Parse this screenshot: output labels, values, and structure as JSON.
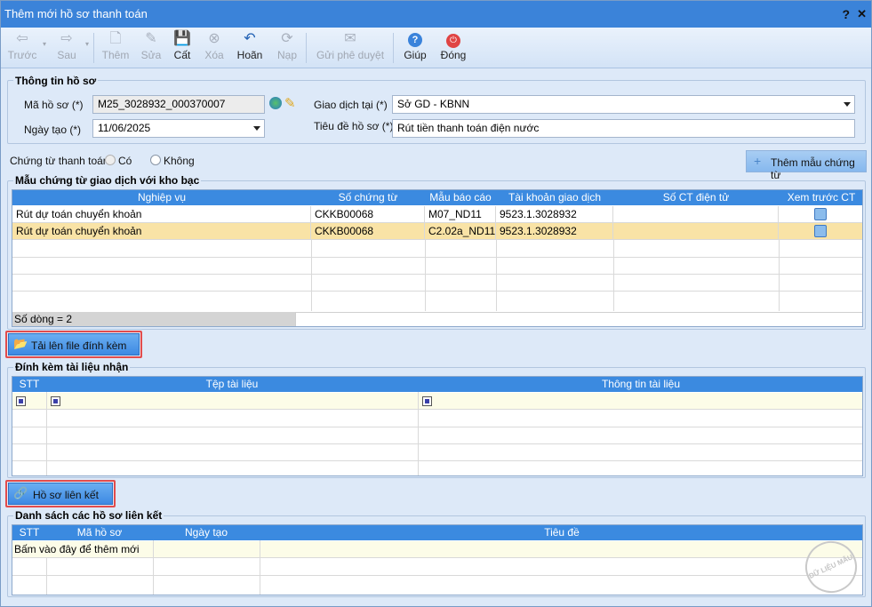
{
  "window": {
    "title": "Thêm mới hồ sơ thanh toán",
    "help": "?",
    "close": "✕"
  },
  "toolbar": {
    "items": [
      {
        "label": "Trước",
        "icon": "arrow-left-icon",
        "glyph": "⇦",
        "enabled": false
      },
      {
        "label": "Sau",
        "icon": "arrow-right-icon",
        "glyph": "⇨",
        "enabled": false
      },
      {
        "label": "Thêm",
        "icon": "new-doc-icon",
        "glyph": "🗋",
        "enabled": false
      },
      {
        "label": "Sửa",
        "icon": "edit-doc-icon",
        "glyph": "✎",
        "enabled": false
      },
      {
        "label": "Cất",
        "icon": "save-icon",
        "glyph": "💾",
        "enabled": true
      },
      {
        "label": "Xóa",
        "icon": "delete-icon",
        "glyph": "⊗",
        "enabled": false
      },
      {
        "label": "Hoãn",
        "icon": "undo-icon",
        "glyph": "↶",
        "enabled": true
      },
      {
        "label": "Nạp",
        "icon": "refresh-icon",
        "glyph": "⟳",
        "enabled": false
      },
      {
        "label": "Gửi phê duyệt",
        "icon": "mail-icon",
        "glyph": "✉",
        "enabled": false
      },
      {
        "label": "Giúp",
        "icon": "help-icon",
        "glyph": "?",
        "enabled": true
      },
      {
        "label": "Đóng",
        "icon": "power-icon",
        "glyph": "⏻",
        "enabled": true
      }
    ]
  },
  "info": {
    "title": "Thông tin hồ sơ",
    "ma_ho_so_label": "Mã hồ sơ (*)",
    "ma_ho_so": "M25_3028932_000370007",
    "ngay_tao_label": "Ngày tạo (*)",
    "ngay_tao": "11/06/2025",
    "giao_dich_label": "Giao dịch tại (*)",
    "giao_dich": "Sở GD - KBNN",
    "tieu_de_label": "Tiêu đề hồ sơ (*)",
    "tieu_de": "Rút tiền thanh toán điện nước"
  },
  "chung_tu": {
    "label": "Chứng từ thanh toán:",
    "option_co": "Có",
    "option_khong": "Không",
    "add_template": "Thêm mẫu chứng từ",
    "add_icon": "+"
  },
  "mau_chung_tu": {
    "title": "Mẫu chứng từ giao dịch với kho bạc",
    "columns": [
      "Nghiệp vụ",
      "Số chứng từ",
      "Mẫu báo cáo",
      "Tài khoản giao dịch",
      "Số CT điện tử",
      "Xem trước CT"
    ],
    "rows": [
      [
        "Rút dự toán chuyển khoản",
        "CKKB00068",
        "M07_ND11",
        "9523.1.3028932",
        ""
      ],
      [
        "Rút dự toán chuyển khoản",
        "CKKB00068",
        "C2.02a_ND11",
        "9523.1.3028932",
        ""
      ]
    ],
    "footer": "Số dòng = 2"
  },
  "upload_button": "Tải lên file đính kèm",
  "dinh_kem": {
    "title": "Đính kèm tài liệu nhận",
    "columns": [
      "STT",
      "Tệp tài liệu",
      "Thông tin tài liệu"
    ]
  },
  "link_button": "Hồ sơ liên kết",
  "lien_ket": {
    "title": "Danh sách các hồ sơ liên kết",
    "columns": [
      "STT",
      "Mã hồ sơ",
      "Ngày tạo",
      "Tiêu đề"
    ],
    "add_row": "Bấm vào đây để thêm mới"
  },
  "watermark": "DỮ LIỆU MẪU",
  "colors": {
    "titlebar": "#3b83d9",
    "header": "#3b8ae0",
    "selected_row": "#f9e3a6",
    "highlight_box": "#e24c4c"
  }
}
